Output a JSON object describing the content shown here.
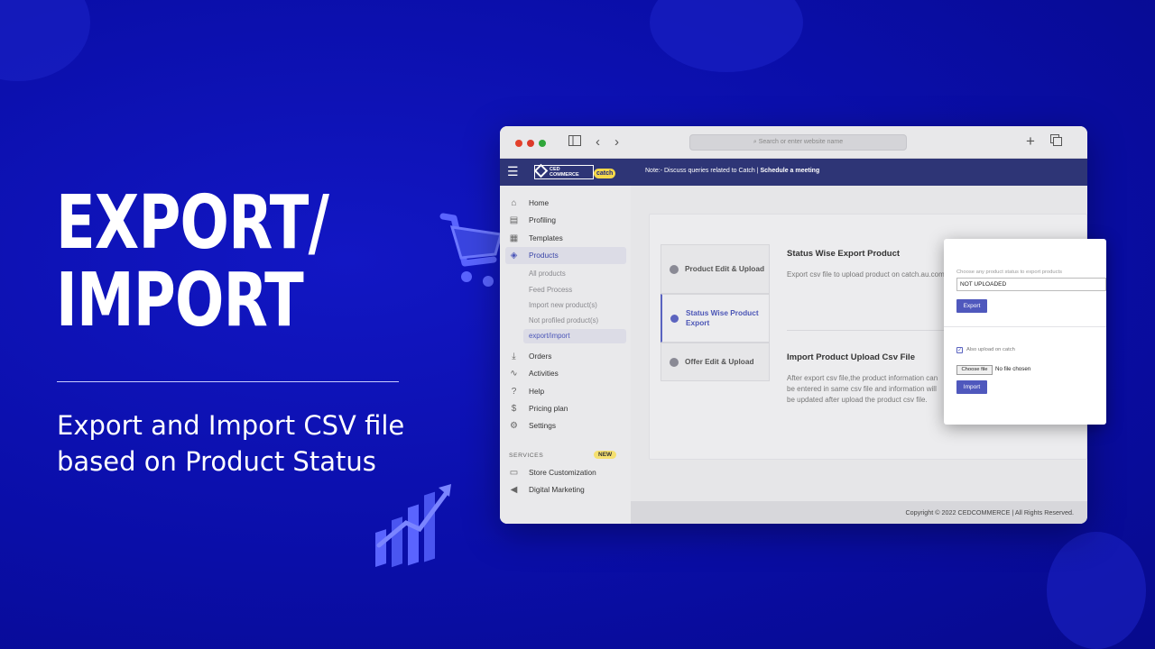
{
  "colors": {
    "background": "#0b0fb0",
    "appbar": "#2e3576",
    "accent": "#4f58bd",
    "catch_badge": "#f5d84a"
  },
  "hero": {
    "title_line1": "EXPORT/",
    "title_line2": "IMPORT",
    "subtitle_line1": "Export and Import CSV file",
    "subtitle_line2": "based on Product Status"
  },
  "browser": {
    "url_placeholder": "Search or enter website name",
    "icons": [
      "sidebar-toggle-icon",
      "back-icon",
      "forward-icon",
      "new-tab-icon",
      "tabs-icon"
    ]
  },
  "appbar": {
    "logo_text_top": "CED",
    "logo_text_bottom": "COMMERCE",
    "catch_label": "catch",
    "note_prefix": "Note:- Discuss queries related to Catch | ",
    "note_link": "Schedule a meeting"
  },
  "sidebar": {
    "items": [
      {
        "label": "Home",
        "icon": "home-icon"
      },
      {
        "label": "Profiling",
        "icon": "profiling-icon"
      },
      {
        "label": "Templates",
        "icon": "templates-icon"
      },
      {
        "label": "Products",
        "icon": "tag-icon"
      }
    ],
    "sub_items": [
      "All products",
      "Feed Process",
      "Import new product(s)",
      "Not profiled product(s)",
      "export/import"
    ],
    "items2": [
      {
        "label": "Orders",
        "icon": "orders-icon"
      },
      {
        "label": "Activities",
        "icon": "activities-icon"
      },
      {
        "label": "Help",
        "icon": "help-icon"
      },
      {
        "label": "Pricing plan",
        "icon": "dollar-icon"
      },
      {
        "label": "Settings",
        "icon": "gear-icon"
      }
    ],
    "services_heading": "SERVICES",
    "services_badge": "NEW",
    "services": [
      {
        "label": "Store Customization",
        "icon": "monitor-icon"
      },
      {
        "label": "Digital Marketing",
        "icon": "megaphone-icon"
      }
    ]
  },
  "main": {
    "tabs": [
      "Product Edit & Upload",
      "Status Wise Product Export",
      "Offer Edit & Upload"
    ],
    "export_title": "Status Wise Export Product",
    "export_text": "Export csv file to upload product on catch.au.com",
    "import_title": "Import Product Upload Csv File",
    "import_text": "After export csv file,the product information can be entered in same csv file and information will be updated after upload the product csv file.",
    "footer": "Copyright © 2022 CEDCOMMERCE | All Rights Reserved."
  },
  "panel": {
    "select_label": "Choose any product status to export products",
    "select_value": "NOT UPLOADED",
    "export_button": "Export",
    "checkbox_label": "Also upload on catch",
    "choose_file_button": "Choose file",
    "file_status": "No file chosen",
    "import_button": "Import"
  }
}
